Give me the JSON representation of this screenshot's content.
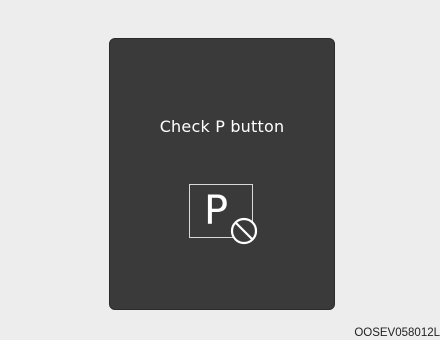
{
  "display": {
    "message": "Check P button",
    "icon_letter": "P",
    "icon": "park-button-prohibited-icon"
  },
  "footer": {
    "image_code": "OOSEV058012L"
  },
  "colors": {
    "page_background": "#ededed",
    "panel_background": "#3a3a3a",
    "text": "#ffffff",
    "icon_stroke": "#d8d8d8"
  }
}
